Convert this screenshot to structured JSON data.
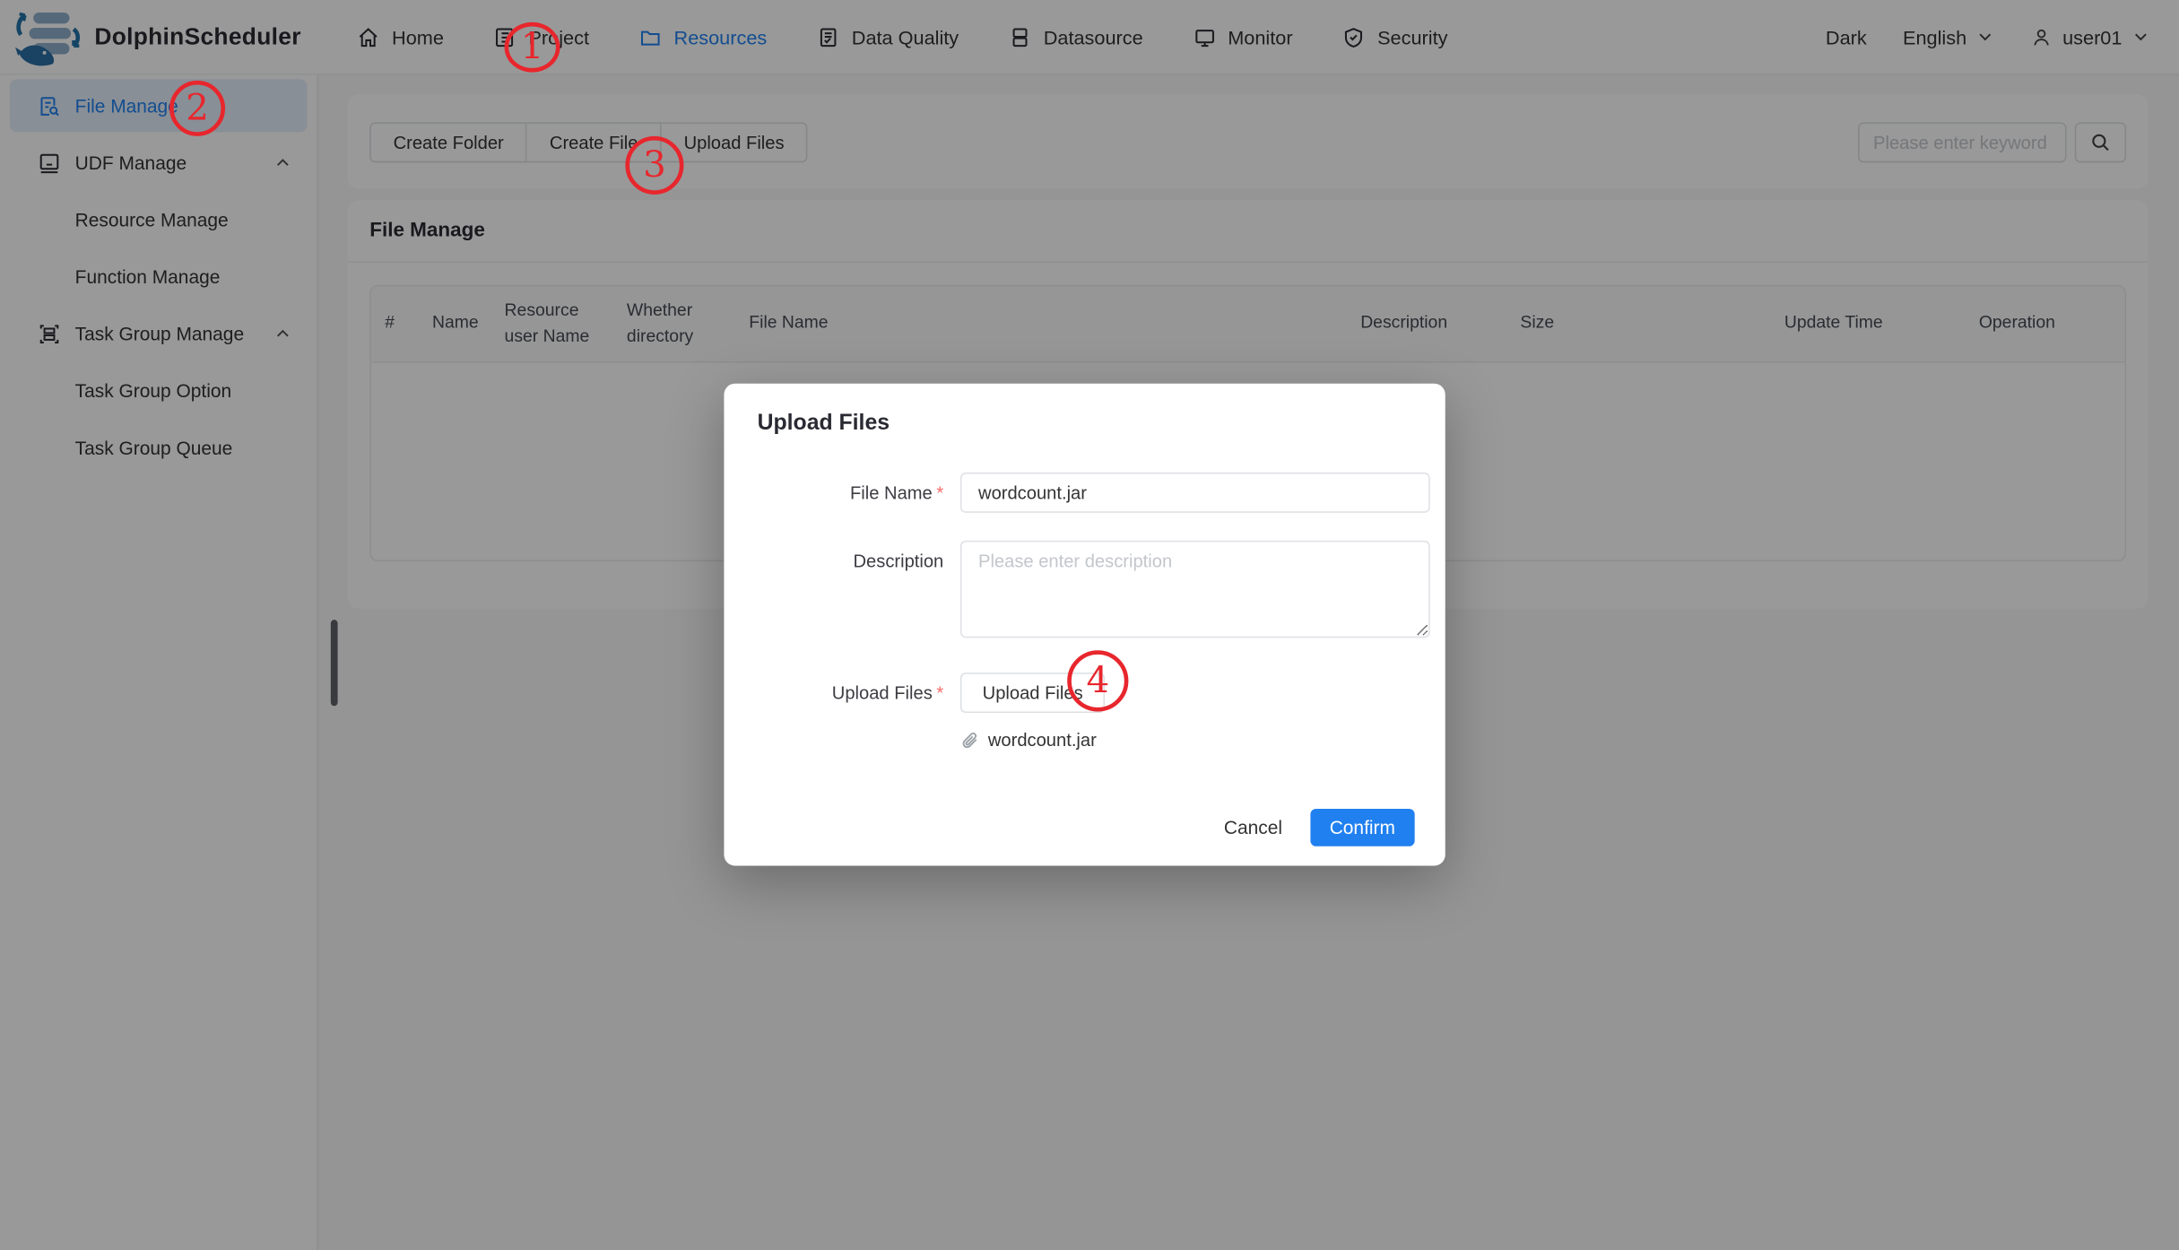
{
  "nav": {
    "title": "DolphinScheduler",
    "items": [
      {
        "label": "Home"
      },
      {
        "label": "Project"
      },
      {
        "label": "Resources"
      },
      {
        "label": "Data Quality"
      },
      {
        "label": "Datasource"
      },
      {
        "label": "Monitor"
      },
      {
        "label": "Security"
      }
    ],
    "theme_label": "Dark",
    "language": "English",
    "username": "user01"
  },
  "sidebar": {
    "items": [
      {
        "label": "File Manage"
      },
      {
        "label": "UDF Manage"
      },
      {
        "label": "Resource Manage"
      },
      {
        "label": "Function Manage"
      },
      {
        "label": "Task Group Manage"
      },
      {
        "label": "Task Group Option"
      },
      {
        "label": "Task Group Queue"
      }
    ]
  },
  "toolbar": {
    "create_folder": "Create Folder",
    "create_file": "Create File",
    "upload_files": "Upload Files",
    "search_placeholder": "Please enter keyword"
  },
  "table": {
    "title": "File Manage",
    "columns": [
      "#",
      "Name",
      "Resource user Name",
      "Whether directory",
      "File Name",
      "Description",
      "Size",
      "Update Time",
      "Operation"
    ]
  },
  "modal": {
    "title": "Upload Files",
    "file_name_label": "File Name",
    "file_name_value": "wordcount.jar",
    "description_label": "Description",
    "description_placeholder": "Please enter description",
    "upload_label": "Upload Files",
    "upload_button": "Upload Files",
    "attachment_name": "wordcount.jar",
    "cancel": "Cancel",
    "confirm": "Confirm",
    "required_mark": "*"
  },
  "annotations": [
    {
      "label": "1"
    },
    {
      "label": "2"
    },
    {
      "label": "3"
    },
    {
      "label": "4"
    }
  ],
  "colors": {
    "primary": "#2080f0",
    "annotation": "#e8262d",
    "overlay": "rgba(0,0,0,0.40)"
  }
}
